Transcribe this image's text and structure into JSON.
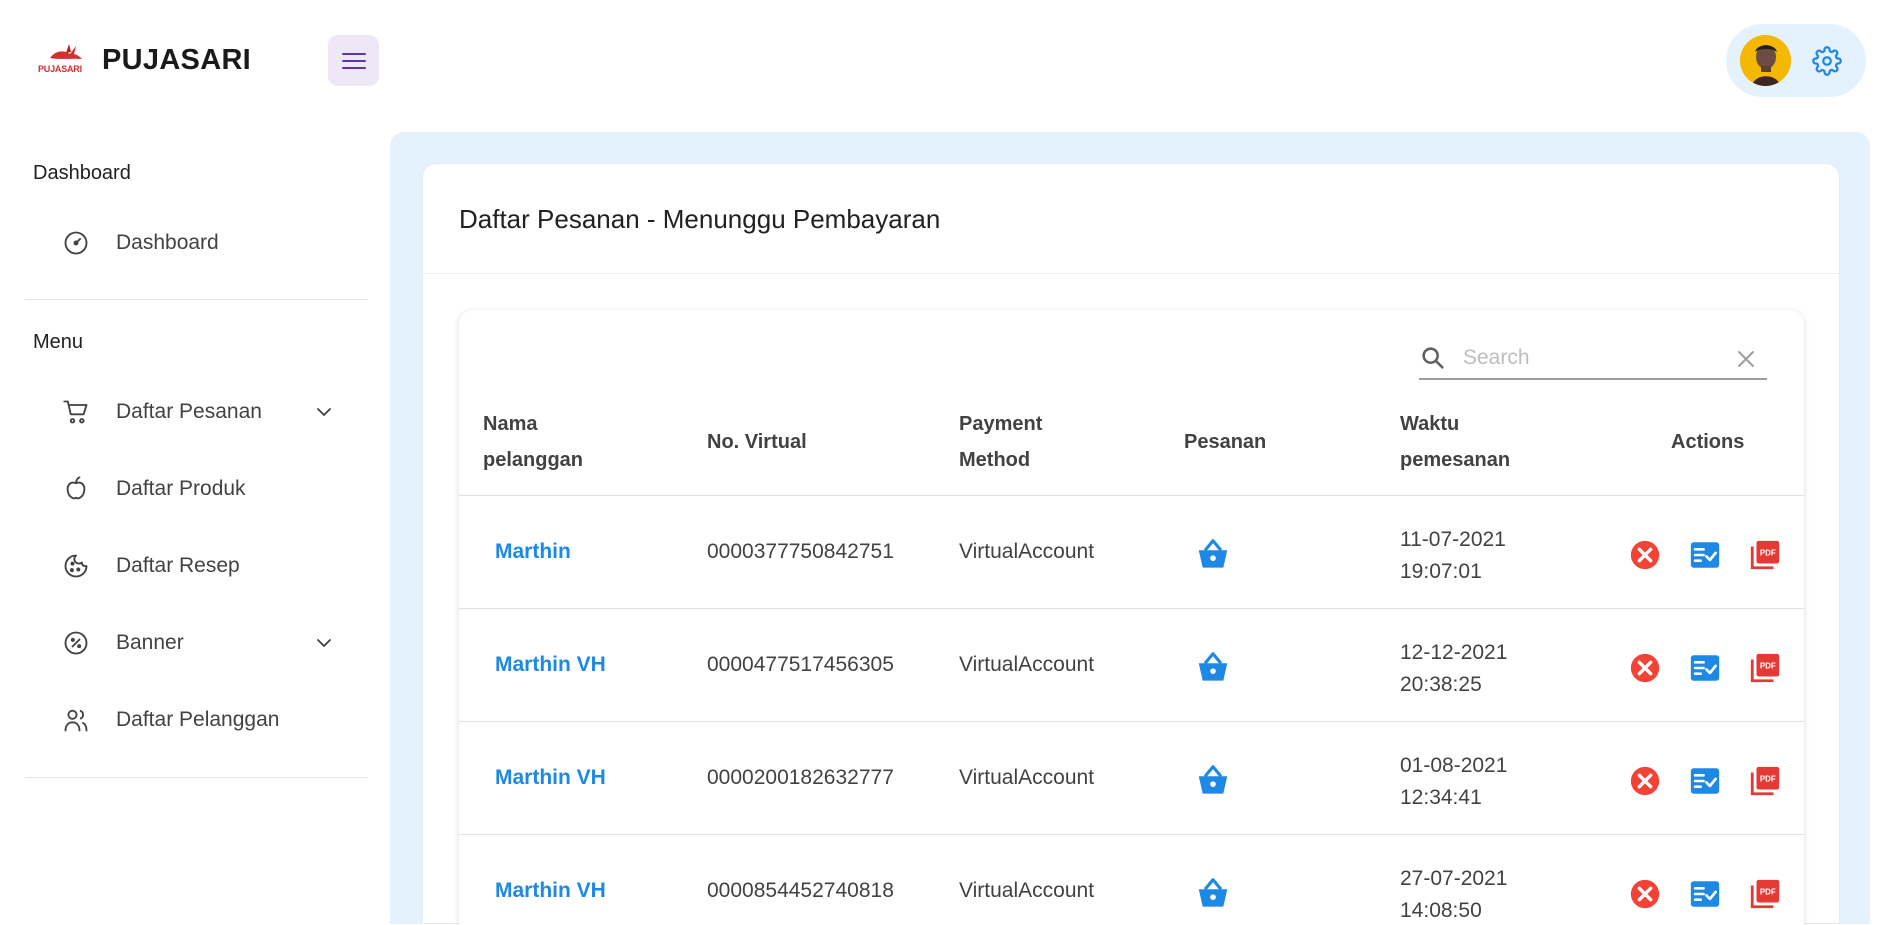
{
  "header": {
    "logo_text": "PUJASARI",
    "brand_name": "PUJASARI",
    "menu_icon": "hamburger-icon",
    "settings_icon": "gear-icon",
    "accent_color": "#1e88e5"
  },
  "sidebar": {
    "sections": [
      {
        "title": "Dashboard",
        "items": [
          {
            "label": "Dashboard",
            "icon": "gauge-icon",
            "expandable": false
          }
        ]
      },
      {
        "title": "Menu",
        "items": [
          {
            "label": "Daftar Pesanan",
            "icon": "cart-icon",
            "expandable": true
          },
          {
            "label": "Daftar Produk",
            "icon": "apple-icon",
            "expandable": false
          },
          {
            "label": "Daftar Resep",
            "icon": "cookie-icon",
            "expandable": false
          },
          {
            "label": "Banner",
            "icon": "discount-icon",
            "expandable": true
          },
          {
            "label": "Daftar Pelanggan",
            "icon": "users-icon",
            "expandable": false
          }
        ]
      }
    ]
  },
  "main": {
    "title": "Daftar Pesanan - Menunggu Pembayaran",
    "search": {
      "placeholder": "Search",
      "value": ""
    },
    "table": {
      "headers": {
        "name_line1": "Nama",
        "name_line2": "pelanggan",
        "virtual": "No. Virtual",
        "payment_line1": "Payment",
        "payment_line2": "Method",
        "order": "Pesanan",
        "time_line1": "Waktu",
        "time_line2": "pemesanan",
        "actions": "Actions"
      },
      "rows": [
        {
          "name": "Marthin",
          "virtual": "0000377750842751",
          "payment": "VirtualAccount",
          "date": "11-07-2021",
          "time": "19:07:01"
        },
        {
          "name": "Marthin VH",
          "virtual": "0000477517456305",
          "payment": "VirtualAccount",
          "date": "12-12-2021",
          "time": "20:38:25"
        },
        {
          "name": "Marthin VH",
          "virtual": "0000200182632777",
          "payment": "VirtualAccount",
          "date": "01-08-2021",
          "time": "12:34:41"
        },
        {
          "name": "Marthin VH",
          "virtual": "0000854452740818",
          "payment": "VirtualAccount",
          "date": "27-07-2021",
          "time": "14:08:50"
        }
      ],
      "action_icons": [
        "cancel-circle-icon",
        "checklist-icon",
        "pdf-icon"
      ],
      "action_colors": {
        "cancel": "#f44336",
        "check": "#1e88e5",
        "pdf": "#e53935"
      }
    }
  }
}
